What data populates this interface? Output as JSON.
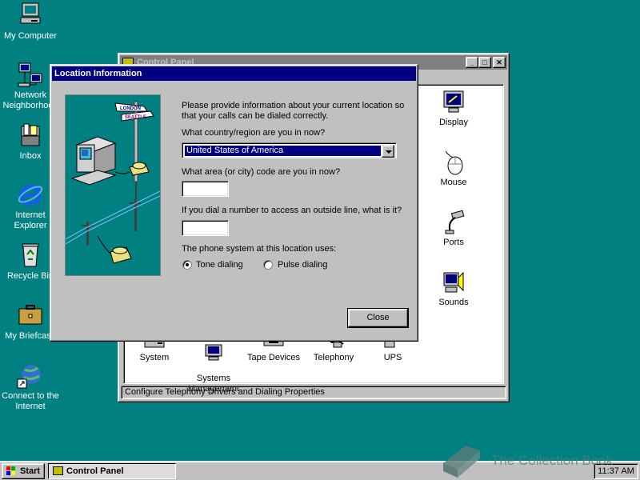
{
  "desktop": {
    "icons": [
      {
        "label": "My Computer",
        "icon": "my-computer-icon"
      },
      {
        "label": "Network\nNeighborhood",
        "icon": "network-icon"
      },
      {
        "label": "Inbox",
        "icon": "inbox-icon"
      },
      {
        "label": "Internet\nExplorer",
        "icon": "ie-icon"
      },
      {
        "label": "Recycle Bin",
        "icon": "recycle-bin-icon"
      },
      {
        "label": "My Briefcase",
        "icon": "briefcase-icon"
      },
      {
        "label": "Connect to the\nInternet",
        "icon": "connect-icon"
      }
    ]
  },
  "control_panel": {
    "title": "Control Panel",
    "items": [
      {
        "label": "Display",
        "icon": "display-icon"
      },
      {
        "label": "Mouse",
        "icon": "mouse-icon"
      },
      {
        "label": "Ports",
        "icon": "ports-icon"
      },
      {
        "label": "Sounds",
        "icon": "sounds-icon"
      },
      {
        "label": "System",
        "icon": "system-icon"
      },
      {
        "label": "Systems\nManagement",
        "icon": "systems-management-icon"
      },
      {
        "label": "Tape Devices",
        "icon": "tape-devices-icon"
      },
      {
        "label": "Telephony",
        "icon": "telephony-icon"
      },
      {
        "label": "UPS",
        "icon": "ups-icon"
      }
    ],
    "status": "Configure Telephony Drivers and Dialing Properties"
  },
  "dialog": {
    "title": "Location Information",
    "intro": "Please provide information about your current location so that your calls can be dialed correctly.",
    "country_question": "What country/region are you in now?",
    "country_value": "United States of America",
    "area_question": "What area (or city) code are you in now?",
    "area_value": "",
    "outside_question": "If you dial a number to access an outside line, what is it?",
    "outside_value": "",
    "phone_system_label": "The phone system at this location uses:",
    "tone_label": "Tone dialing",
    "pulse_label": "Pulse dialing",
    "tone_selected": true,
    "close_label": "Close",
    "art_sign_1": "LONDON",
    "art_sign_2": "SEATTLE"
  },
  "taskbar": {
    "start_label": "Start",
    "task_label": "Control Panel",
    "clock": "11:37 AM"
  },
  "watermark": "The Collection Book",
  "colors": {
    "desktop": "#008080",
    "title_active": "#000080",
    "title_inactive": "#808080",
    "face": "#c0c0c0"
  }
}
